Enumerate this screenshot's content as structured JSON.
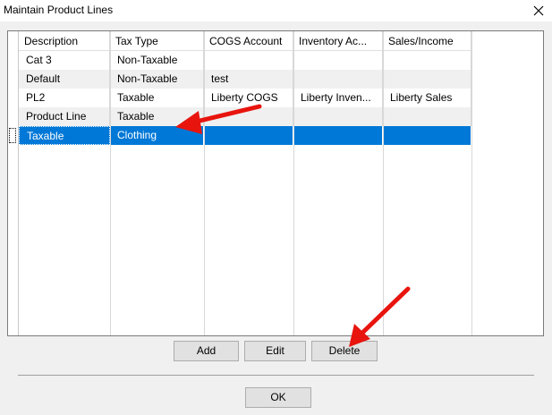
{
  "window": {
    "title": "Maintain Product Lines",
    "close_label": "×"
  },
  "grid": {
    "columns": [
      "Description",
      "Tax Type",
      "COGS Account",
      "Inventory Ac...",
      "Sales/Income"
    ],
    "rows": [
      [
        "Cat 3",
        "Non-Taxable",
        "",
        "",
        ""
      ],
      [
        "Default",
        "Non-Taxable",
        "test",
        "",
        ""
      ],
      [
        "PL2",
        "Taxable",
        "Liberty COGS",
        "Liberty Inven...",
        "Liberty Sales"
      ],
      [
        "Product Line",
        "Taxable",
        "",
        "",
        ""
      ],
      [
        "Taxable",
        "Clothing",
        "",
        "",
        ""
      ]
    ],
    "selected_row": 4
  },
  "buttons": {
    "add": "Add",
    "edit": "Edit",
    "delete": "Delete",
    "ok": "OK"
  },
  "annotations": {
    "arrow_color": "#e8140e"
  }
}
